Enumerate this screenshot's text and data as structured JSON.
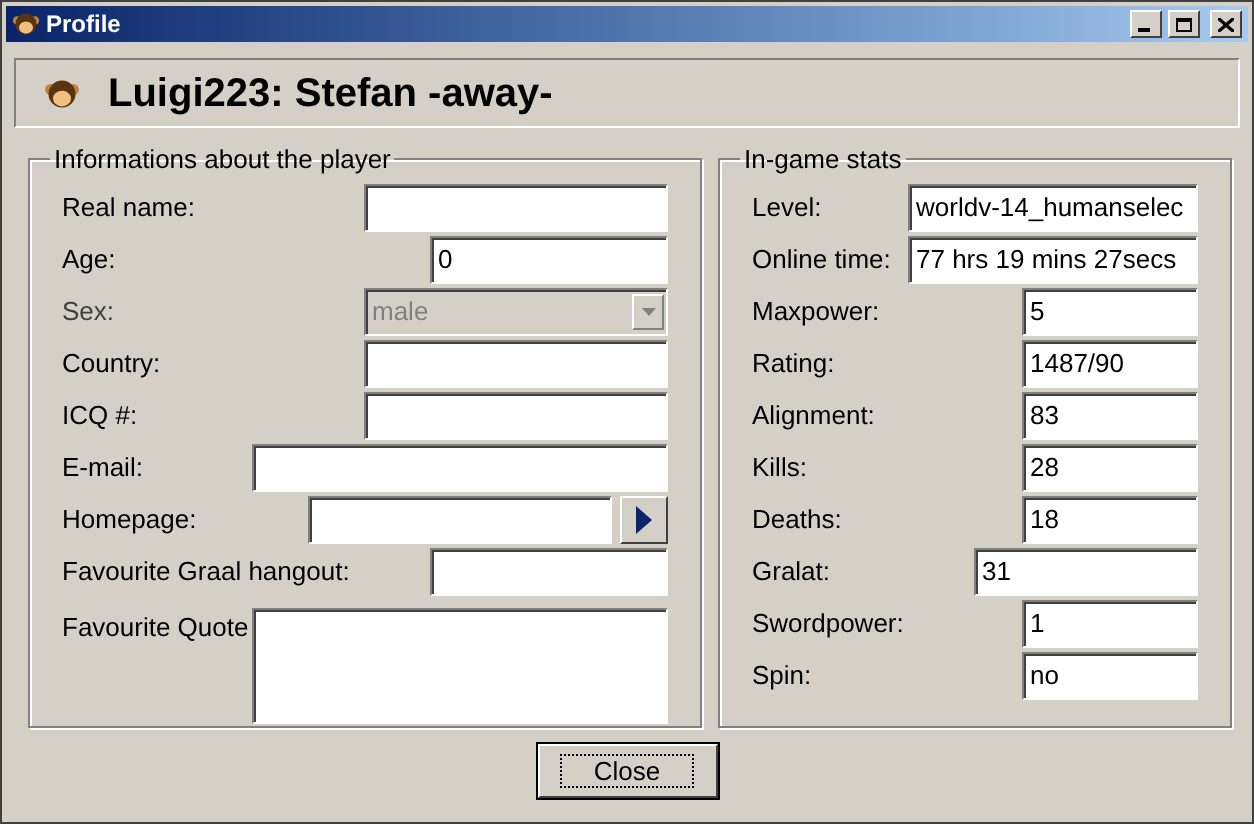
{
  "window": {
    "title": "Profile"
  },
  "header": {
    "title": "Luigi223: Stefan -away-"
  },
  "player_info": {
    "title": "Informations about the player",
    "fields": [
      {
        "label": "Real name:",
        "kind": "text",
        "disabled": false
      },
      {
        "label": "Age:",
        "kind": "text",
        "value": "0",
        "disabled": false
      },
      {
        "label": "Sex:",
        "kind": "dropdown",
        "value": "male",
        "disabled": true
      },
      {
        "label": "Country:",
        "kind": "text",
        "disabled": false
      },
      {
        "label": "ICQ #:",
        "kind": "text",
        "disabled": false
      },
      {
        "label": "E-mail:",
        "kind": "text",
        "disabled": false
      },
      {
        "label": "Homepage:",
        "kind": "link",
        "disabled": false
      },
      {
        "label": "Favourite Graal hangout:",
        "kind": "text",
        "disabled": false
      },
      {
        "label": "Favourite Quote",
        "kind": "textarea",
        "disabled": false
      }
    ]
  },
  "stats": {
    "title": "In-game stats",
    "fields": [
      {
        "label": "Level:",
        "value": "worldv-14_humanselec"
      },
      {
        "label": "Online time:",
        "value": "77 hrs 19 mins 27secs"
      },
      {
        "label": "Maxpower:",
        "value": "5"
      },
      {
        "label": "Rating:",
        "value": "1487/90"
      },
      {
        "label": "Alignment:",
        "value": "83"
      },
      {
        "label": "Kills:",
        "value": "28"
      },
      {
        "label": "Deaths:",
        "value": "18"
      },
      {
        "label": "Gralat:",
        "value": "31"
      },
      {
        "label": "Swordpower:",
        "value": "1"
      },
      {
        "label": "Spin:",
        "value": "no"
      }
    ]
  },
  "buttons": [
    {
      "label": "Close",
      "focused": true
    }
  ]
}
